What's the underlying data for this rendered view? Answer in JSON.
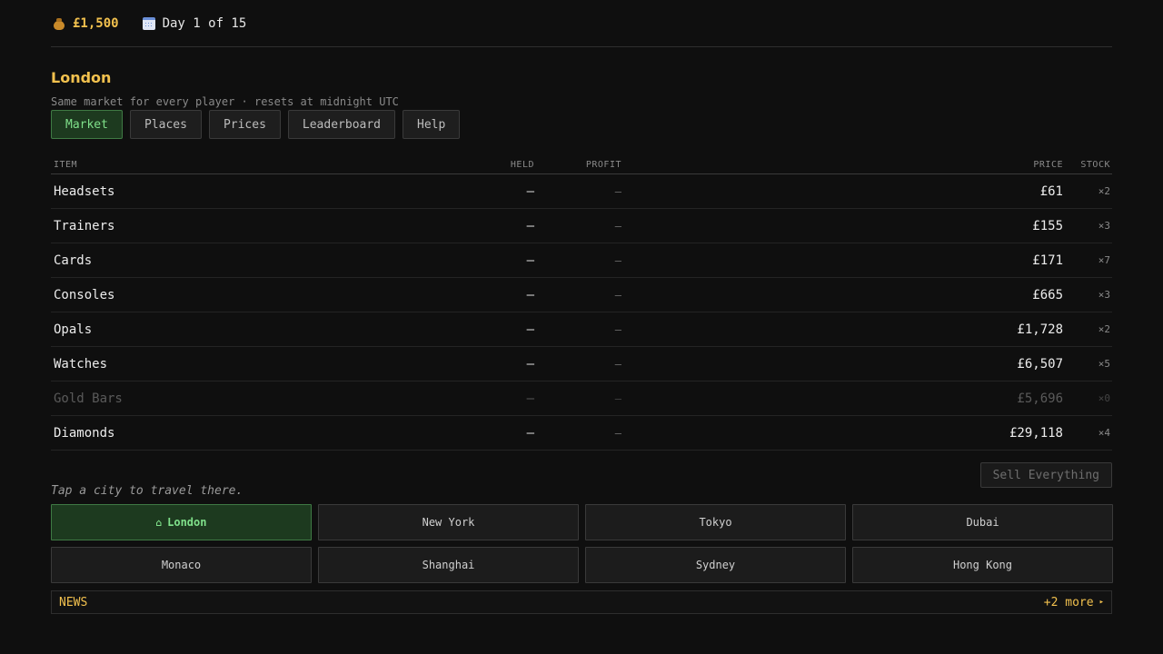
{
  "status": {
    "money": "£1,500",
    "day": "Day 1 of 15",
    "money_icon": "money-bag-icon",
    "day_icon": "calendar-icon"
  },
  "location": {
    "city": "London",
    "subtitle": "Same market for every player · resets at midnight UTC"
  },
  "tabs": [
    {
      "label": "Market",
      "active": true
    },
    {
      "label": "Places",
      "active": false
    },
    {
      "label": "Prices",
      "active": false
    },
    {
      "label": "Leaderboard",
      "active": false
    },
    {
      "label": "Help",
      "active": false
    }
  ],
  "market": {
    "headers": {
      "item": "ITEM",
      "held": "HELD",
      "profit": "PROFIT",
      "price": "PRICE",
      "stock": "STOCK"
    },
    "rows": [
      {
        "item": "Headsets",
        "held": "—",
        "profit": "–",
        "price": "£61",
        "stock": "×2",
        "available": true
      },
      {
        "item": "Trainers",
        "held": "—",
        "profit": "–",
        "price": "£155",
        "stock": "×3",
        "available": true
      },
      {
        "item": "Cards",
        "held": "—",
        "profit": "–",
        "price": "£171",
        "stock": "×7",
        "available": true
      },
      {
        "item": "Consoles",
        "held": "—",
        "profit": "–",
        "price": "£665",
        "stock": "×3",
        "available": true
      },
      {
        "item": "Opals",
        "held": "—",
        "profit": "–",
        "price": "£1,728",
        "stock": "×2",
        "available": true
      },
      {
        "item": "Watches",
        "held": "—",
        "profit": "–",
        "price": "£6,507",
        "stock": "×5",
        "available": true
      },
      {
        "item": "Gold Bars",
        "held": "—",
        "profit": "–",
        "price": "£5,696",
        "stock": "×0",
        "available": false
      },
      {
        "item": "Diamonds",
        "held": "—",
        "profit": "–",
        "price": "£29,118",
        "stock": "×4",
        "available": true
      }
    ]
  },
  "actions": {
    "sell_all": "Sell Everything"
  },
  "travel": {
    "hint": "Tap a city to travel there.",
    "current_icon": "⌂",
    "cities": [
      "London",
      "New York",
      "Tokyo",
      "Dubai",
      "Monaco",
      "Shanghai",
      "Sydney",
      "Hong Kong"
    ],
    "current": "London"
  },
  "news": {
    "label": "NEWS",
    "more": "+2 more",
    "more_icon": "▸"
  },
  "colors": {
    "accent": "#f2c14e",
    "active_green": "#7fe08a",
    "background": "#0f0f0f"
  }
}
